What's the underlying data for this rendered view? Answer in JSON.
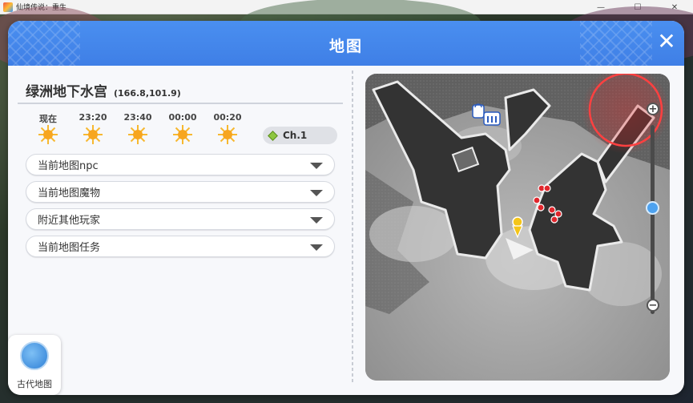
{
  "window": {
    "title": "仙境传说：重生",
    "min": "—",
    "max": "☐",
    "close": "✕"
  },
  "dialog": {
    "title": "地图",
    "close_icon": "close-icon"
  },
  "location": {
    "name": "绿洲地下水宫",
    "coords": "(166.8,101.9)"
  },
  "weather": [
    {
      "time": "现在",
      "icon": "sun-icon"
    },
    {
      "time": "23:20",
      "icon": "sun-icon"
    },
    {
      "time": "23:40",
      "icon": "sun-icon"
    },
    {
      "time": "00:00",
      "icon": "sun-icon"
    },
    {
      "time": "00:20",
      "icon": "sun-icon"
    }
  ],
  "channel": {
    "label": "Ch.1"
  },
  "sections": [
    {
      "label": "当前地图npc"
    },
    {
      "label": "当前地图魔物"
    },
    {
      "label": "附近其他玩家"
    },
    {
      "label": "当前地图任务"
    }
  ],
  "ancient_map": {
    "label": "古代地图"
  },
  "zoom": {
    "plus": "+",
    "minus": "−",
    "level": 0.5
  },
  "colors": {
    "header_blue": "#3f7fe6",
    "accent_blue": "#4da2f0",
    "monster_red": "#e0262c",
    "player_yellow": "#f5c518",
    "sun": "#f7a620"
  }
}
